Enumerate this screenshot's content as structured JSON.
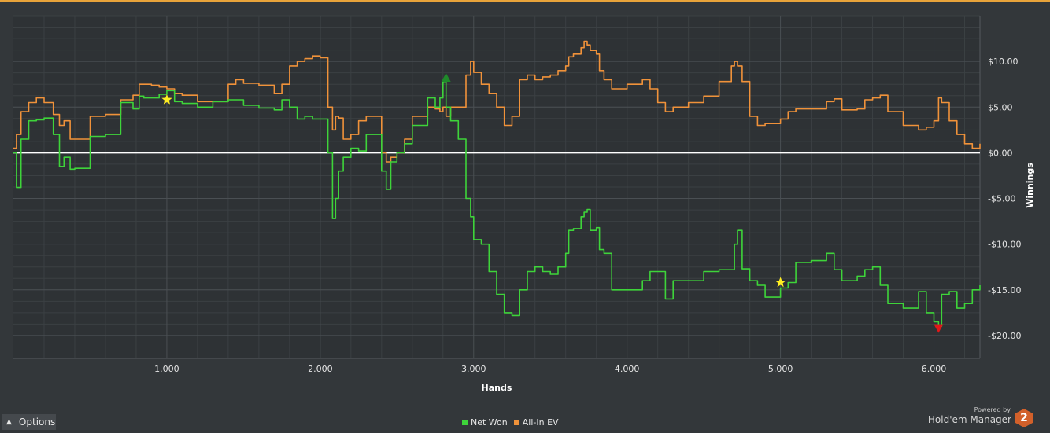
{
  "app": {
    "powered_by": "Powered by",
    "product_name": "Hold'em Manager",
    "badge": "2"
  },
  "options_button": {
    "label": "Options"
  },
  "colors": {
    "net_won": "#3ed43a",
    "all_in_ev": "#f0923a",
    "zero_line": "#ffffff",
    "marker_star": "#ffee22",
    "marker_peak": "#1f8a2a",
    "marker_trough": "#e01818"
  },
  "chart_data": {
    "type": "line",
    "xlabel": "Hands",
    "ylabel": "Winnings",
    "xlim": [
      0,
      6300
    ],
    "ylim": [
      -22.5,
      15
    ],
    "x_ticks": [
      1000,
      2000,
      3000,
      4000,
      5000,
      6000
    ],
    "x_tick_labels": [
      "1.000",
      "2.000",
      "3.000",
      "4.000",
      "5.000",
      "6.000"
    ],
    "y_ticks": [
      10,
      5,
      0,
      -5,
      -10,
      -15,
      -20
    ],
    "y_tick_labels": [
      "$10.00",
      "$5.00",
      "$0.00",
      "-$5.00",
      "-$10.00",
      "-$15.00",
      "-$20.00"
    ],
    "grid": true,
    "legend_position": "bottom-center",
    "series": [
      {
        "name": "Net Won",
        "x": [
          0,
          20,
          50,
          100,
          150,
          200,
          260,
          300,
          330,
          370,
          400,
          500,
          600,
          700,
          780,
          820,
          850,
          900,
          950,
          1000,
          1050,
          1100,
          1200,
          1300,
          1400,
          1450,
          1500,
          1600,
          1700,
          1750,
          1800,
          1850,
          1900,
          1950,
          2000,
          2050,
          2080,
          2100,
          2120,
          2150,
          2200,
          2250,
          2300,
          2400,
          2430,
          2460,
          2500,
          2550,
          2600,
          2700,
          2750,
          2780,
          2800,
          2820,
          2850,
          2900,
          2950,
          2980,
          3000,
          3050,
          3100,
          3150,
          3200,
          3250,
          3300,
          3350,
          3400,
          3450,
          3500,
          3550,
          3600,
          3620,
          3650,
          3700,
          3720,
          3740,
          3760,
          3800,
          3820,
          3850,
          3900,
          4000,
          4100,
          4150,
          4200,
          4250,
          4300,
          4400,
          4500,
          4600,
          4680,
          4700,
          4720,
          4750,
          4800,
          4850,
          4900,
          5000,
          5050,
          5100,
          5200,
          5300,
          5350,
          5400,
          5500,
          5550,
          5600,
          5650,
          5700,
          5800,
          5900,
          5950,
          6000,
          6030,
          6050,
          6100,
          6150,
          6200,
          6250,
          6300
        ],
        "y": [
          0,
          -3.8,
          1.5,
          3.5,
          3.6,
          3.8,
          2,
          -1.5,
          -0.5,
          -1.8,
          -1.7,
          1.8,
          2,
          5.5,
          4.8,
          6.2,
          6,
          6,
          6.4,
          6.8,
          5.6,
          5.4,
          5,
          5.6,
          5.8,
          5.8,
          5.2,
          4.9,
          4.7,
          5.8,
          5,
          3.7,
          4,
          3.7,
          3.7,
          0,
          -7.2,
          -5,
          -2,
          -0.5,
          0.5,
          0.2,
          2,
          -2,
          -4,
          -1,
          0,
          1,
          3,
          6,
          5,
          6,
          7.8,
          5,
          3.5,
          1.5,
          -5,
          -7,
          -9.5,
          -10,
          -13,
          -15.5,
          -17.5,
          -17.8,
          -15,
          -13,
          -12.5,
          -13,
          -13.3,
          -12.5,
          -11,
          -8.5,
          -8.3,
          -7,
          -6.5,
          -6.2,
          -8.5,
          -8.2,
          -10.6,
          -11,
          -15,
          -15,
          -14,
          -13,
          -13,
          -16,
          -14,
          -14,
          -13,
          -12.8,
          -12.8,
          -10,
          -8.5,
          -12.7,
          -14,
          -14.5,
          -15.8,
          -14.8,
          -14.2,
          -12,
          -11.8,
          -11,
          -12.8,
          -14,
          -13.5,
          -12.8,
          -12.5,
          -14.5,
          -16.5,
          -17,
          -15.2,
          -17.5,
          -18.5,
          -19,
          -15.5,
          -15.2,
          -17,
          -16.5,
          -15,
          -14.5
        ]
      },
      {
        "name": "All-In EV",
        "x": [
          0,
          20,
          50,
          100,
          150,
          200,
          260,
          300,
          330,
          370,
          400,
          500,
          600,
          700,
          780,
          820,
          850,
          900,
          950,
          1000,
          1050,
          1100,
          1200,
          1300,
          1400,
          1450,
          1500,
          1600,
          1700,
          1750,
          1800,
          1850,
          1900,
          1950,
          2000,
          2050,
          2080,
          2100,
          2120,
          2150,
          2200,
          2250,
          2300,
          2400,
          2430,
          2460,
          2500,
          2550,
          2600,
          2700,
          2750,
          2780,
          2800,
          2820,
          2850,
          2900,
          2950,
          2980,
          3000,
          3050,
          3100,
          3150,
          3200,
          3250,
          3300,
          3350,
          3400,
          3450,
          3500,
          3550,
          3600,
          3620,
          3650,
          3700,
          3720,
          3740,
          3760,
          3800,
          3820,
          3850,
          3900,
          4000,
          4100,
          4150,
          4200,
          4250,
          4300,
          4400,
          4500,
          4600,
          4680,
          4700,
          4720,
          4750,
          4800,
          4850,
          4900,
          5000,
          5050,
          5100,
          5200,
          5300,
          5350,
          5400,
          5500,
          5550,
          5600,
          5650,
          5700,
          5800,
          5900,
          5950,
          6000,
          6030,
          6050,
          6100,
          6150,
          6200,
          6250,
          6300
        ],
        "y": [
          0.5,
          2,
          4.5,
          5.5,
          6,
          5.5,
          4.2,
          3,
          3.5,
          1.5,
          1.5,
          4,
          4.2,
          5.8,
          6.3,
          7.5,
          7.5,
          7.4,
          7.2,
          7,
          6.5,
          6.3,
          5.6,
          5.6,
          7.5,
          8,
          7.6,
          7.4,
          6.5,
          7.5,
          9.5,
          10,
          10.3,
          10.6,
          10.4,
          5,
          2.5,
          4,
          3.8,
          1.5,
          2,
          3.5,
          4,
          0,
          -1,
          -0.5,
          0,
          1.5,
          4,
          5,
          4.8,
          4.5,
          5,
          4,
          5,
          5,
          8.5,
          10,
          8.8,
          7.5,
          6.5,
          5,
          3,
          4,
          8,
          8.5,
          8,
          8.3,
          8.5,
          9,
          9.5,
          10.5,
          10.8,
          11.5,
          12.2,
          11.8,
          11.2,
          10.8,
          9,
          8,
          7,
          7.5,
          8,
          7,
          5.5,
          4.5,
          5,
          5.5,
          6.2,
          7.8,
          9.5,
          10,
          9.5,
          7.8,
          4,
          3,
          3.2,
          3.7,
          4.5,
          4.8,
          4.8,
          5.6,
          5.9,
          4.7,
          4.8,
          5.8,
          6,
          6.3,
          4.5,
          3,
          2.5,
          2.8,
          3.5,
          6,
          5.5,
          3.5,
          2,
          1,
          0.5,
          1
        ]
      }
    ],
    "markers": [
      {
        "series": "Net Won",
        "shape": "star",
        "x": 1000,
        "y": 5.8
      },
      {
        "series": "Net Won",
        "shape": "star",
        "x": 5000,
        "y": -14.2
      },
      {
        "series": "Net Won",
        "shape": "triangle-up",
        "x": 2820,
        "y": 8.2
      },
      {
        "series": "Net Won",
        "shape": "triangle-down",
        "x": 6030,
        "y": -19.2
      }
    ]
  }
}
